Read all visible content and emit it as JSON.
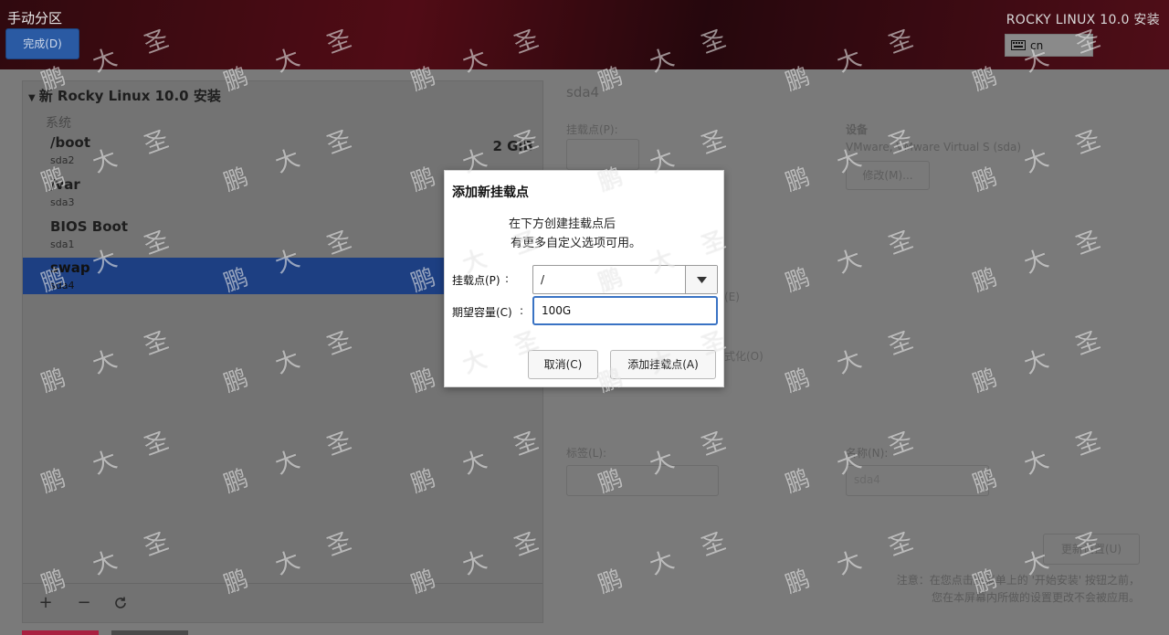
{
  "header": {
    "title": "手动分区",
    "done_label": "完成(D)",
    "product": "ROCKY LINUX 10.0 安装",
    "keyboard_layout": "cn"
  },
  "left": {
    "group_title": "新 Rocky Linux 10.0 安装",
    "system_label": "系统",
    "partitions": [
      {
        "mount": "/boot",
        "device": "sda2",
        "size": "2 GiB"
      },
      {
        "mount": "/var",
        "device": "sda3",
        "size": ""
      },
      {
        "mount": "BIOS Boot",
        "device": "sda1",
        "size": ""
      },
      {
        "mount": "swap",
        "device": "sda4",
        "size": "",
        "selected": true
      }
    ],
    "toolbar": {
      "add": "+",
      "remove": "−",
      "refresh": "C"
    }
  },
  "right": {
    "title": "sda4",
    "mount_label": "挂载点(P):",
    "device_label": "设备",
    "device_value": "VMware, VMware Virtual S (sda)",
    "modify_label": "修改(M)...",
    "label_label": "标签(L):",
    "name_label": "名称(N):",
    "name_value": "sda4",
    "update_label": "更新设置(U)",
    "fragment_e": "(E)",
    "fragment_o": "式化(O)",
    "note": "注意：在您点击主菜单上的 '开始安装' 按钮之前，您在本屏幕内所做的设置更改不会被应用。"
  },
  "dialog": {
    "title": "添加新挂载点",
    "message_line1": "在下方创建挂载点后",
    "message_line2": "有更多自定义选项可用。",
    "mount_label": "挂载点(P)",
    "capacity_label": "期望容量(C)",
    "colon": ":",
    "mount_value": "/",
    "capacity_value": "100G",
    "cancel_label": "取消(C)",
    "add_label": "添加挂载点(A)"
  },
  "watermark": {
    "text": [
      "鹏",
      "大",
      "圣"
    ]
  },
  "colors": {
    "accent": "#2a5aa3",
    "selected_row": "#1d3f82",
    "focus_border": "#3a73c4"
  }
}
